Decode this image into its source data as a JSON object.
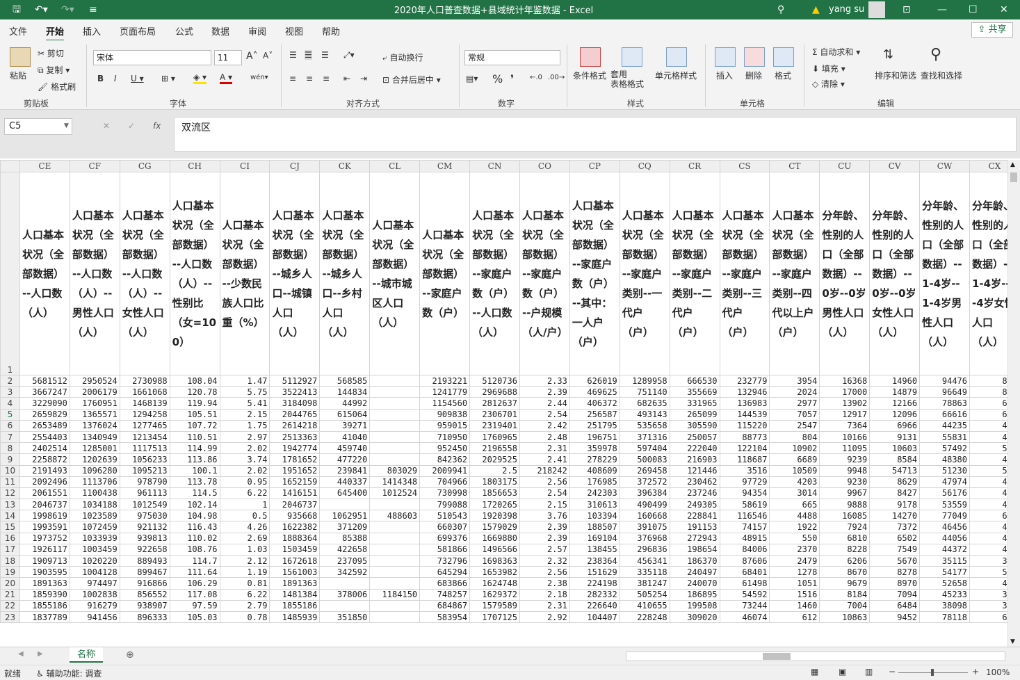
{
  "titlebar": {
    "title": "2020年人口普查数据+县域统计年鉴数据  -  Excel",
    "user": "yang su"
  },
  "menu": {
    "tabs": [
      "文件",
      "开始",
      "插入",
      "页面布局",
      "公式",
      "数据",
      "审阅",
      "视图",
      "帮助"
    ],
    "active": "开始",
    "share": "共享"
  },
  "ribbon": {
    "paste": "粘贴",
    "cut": "剪切",
    "copy": "复制",
    "format_painter": "格式刷",
    "clipboard": "剪贴板",
    "font_name": "宋体",
    "font_size": "11",
    "font_group": "字体",
    "wrap": "自动换行",
    "merge": "合并后居中",
    "align_group": "对齐方式",
    "num_format": "常规",
    "num_group": "数字",
    "cond_fmt": "条件格式",
    "table_fmt": "套用\n表格格式",
    "cell_style": "单元格样式",
    "style_group": "样式",
    "insert": "插入",
    "delete": "删除",
    "format": "格式",
    "cells_group": "单元格",
    "autosum": "自动求和",
    "fill": "填充",
    "clear": "清除",
    "sort": "排序和筛选",
    "find": "查找和选择",
    "edit_group": "编辑"
  },
  "formula_bar": {
    "name_box": "C5",
    "content": "双流区"
  },
  "columns": [
    "CE",
    "CF",
    "CG",
    "CH",
    "CI",
    "CJ",
    "CK",
    "CL",
    "CM",
    "CN",
    "CO",
    "CP",
    "CQ",
    "CR",
    "CS",
    "CT",
    "CU",
    "CV",
    "CW",
    "CX"
  ],
  "headers": [
    "人口基本状况（全部数据）--人口数（人）",
    "人口基本状况（全部数据）--人口数（人）--男性人口（人）",
    "人口基本状况（全部数据）--人口数（人）--女性人口（人）",
    "人口基本状况（全部数据）--人口数（人）--性别比（女=100）",
    "人口基本状况（全部数据）--少数民族人口比重（%）",
    "人口基本状况（全部数据）--城乡人口--城镇人口（人）",
    "人口基本状况（全部数据）--城乡人口--乡村人口（人）",
    "人口基本状况（全部数据）--城市城区人口（人）",
    "人口基本状况（全部数据）--家庭户数（户）",
    "人口基本状况（全部数据）--家庭户数（户）--人口数（人）",
    "人口基本状况（全部数据）--家庭户数（户）--户规模（人/户）",
    "人口基本状况（全部数据）--家庭户数（户）--其中：一人户（户）",
    "人口基本状况（全部数据）--家庭户类别--一代户（户）",
    "人口基本状况（全部数据）--家庭户类别--二代户（户）",
    "人口基本状况（全部数据）--家庭户类别--三代户（户）",
    "人口基本状况（全部数据）--家庭户类别--四代以上户（户）",
    "分年龄、性别的人口（全部数据）--0岁--0岁男性人口（人）",
    "分年龄、性别的人口（全部数据）--0岁--0岁女性人口（人）",
    "分年龄、性别的人口（全部数据）--1-4岁--1-4岁男性人口（人）",
    "分年龄、性别的人口（全部数据）--1-4岁--1-4岁女性人口（人）"
  ],
  "rows": [
    [
      "5681512",
      "2950524",
      "2730988",
      "108.04",
      "1.47",
      "5112927",
      "568585",
      "",
      "2193221",
      "5120736",
      "2.33",
      "626019",
      "1289958",
      "666530",
      "232779",
      "3954",
      "16368",
      "14960",
      "94476",
      "869"
    ],
    [
      "3667247",
      "2006179",
      "1661068",
      "120.78",
      "5.75",
      "3522413",
      "144834",
      "",
      "1241779",
      "2969688",
      "2.39",
      "469625",
      "751140",
      "355669",
      "132946",
      "2024",
      "17000",
      "14879",
      "96649",
      "837"
    ],
    [
      "3229090",
      "1760951",
      "1468139",
      "119.94",
      "5.41",
      "3184098",
      "44992",
      "",
      "1154560",
      "2812637",
      "2.44",
      "406372",
      "682635",
      "331965",
      "136983",
      "2977",
      "13902",
      "12166",
      "78863",
      "695"
    ],
    [
      "2659829",
      "1365571",
      "1294258",
      "105.51",
      "2.15",
      "2044765",
      "615064",
      "",
      "909838",
      "2306701",
      "2.54",
      "256587",
      "493143",
      "265099",
      "144539",
      "7057",
      "12917",
      "12096",
      "66616",
      "627"
    ],
    [
      "2653489",
      "1376024",
      "1277465",
      "107.72",
      "1.75",
      "2614218",
      "39271",
      "",
      "959015",
      "2319401",
      "2.42",
      "251795",
      "535658",
      "305590",
      "115220",
      "2547",
      "7364",
      "6966",
      "44235",
      "409"
    ],
    [
      "2554403",
      "1340949",
      "1213454",
      "110.51",
      "2.97",
      "2513363",
      "41040",
      "",
      "710950",
      "1760965",
      "2.48",
      "196751",
      "371316",
      "250057",
      "88773",
      "804",
      "10166",
      "9131",
      "55831",
      "496"
    ],
    [
      "2402514",
      "1285001",
      "1117513",
      "114.99",
      "2.02",
      "1942774",
      "459740",
      "",
      "952450",
      "2196558",
      "2.31",
      "359978",
      "597404",
      "222040",
      "122104",
      "10902",
      "11095",
      "10603",
      "57492",
      "529"
    ],
    [
      "2258872",
      "1202639",
      "1056233",
      "113.86",
      "3.74",
      "1781652",
      "477220",
      "",
      "842362",
      "2029525",
      "2.41",
      "278229",
      "500083",
      "216903",
      "118687",
      "6689",
      "9239",
      "8584",
      "48380",
      "446"
    ],
    [
      "2191493",
      "1096280",
      "1095213",
      "100.1",
      "2.02",
      "1951652",
      "239841",
      "803029",
      "2009941",
      "2.5",
      "218242",
      "408609",
      "269458",
      "121446",
      "3516",
      "10509",
      "9948",
      "54713",
      "51230",
      "589"
    ],
    [
      "2092496",
      "1113706",
      "978790",
      "113.78",
      "0.95",
      "1652159",
      "440337",
      "1414348",
      "704966",
      "1803175",
      "2.56",
      "176985",
      "372572",
      "230462",
      "97729",
      "4203",
      "9230",
      "8629",
      "47974",
      "443"
    ],
    [
      "2061551",
      "1100438",
      "961113",
      "114.5",
      "6.22",
      "1416151",
      "645400",
      "1012524",
      "730998",
      "1856653",
      "2.54",
      "242303",
      "396384",
      "237246",
      "94354",
      "3014",
      "9967",
      "8427",
      "56176",
      "455"
    ],
    [
      "2046737",
      "1034188",
      "1012549",
      "102.14",
      "1",
      "2046737",
      "",
      "",
      "799088",
      "1720265",
      "2.15",
      "310613",
      "490499",
      "249305",
      "58619",
      "665",
      "9888",
      "9178",
      "53559",
      "497"
    ],
    [
      "1998619",
      "1023589",
      "975030",
      "104.98",
      "0.5",
      "935668",
      "1062951",
      "488603",
      "510543",
      "1920398",
      "3.76",
      "103394",
      "160668",
      "228841",
      "116546",
      "4488",
      "16085",
      "14270",
      "77049",
      "692"
    ],
    [
      "1993591",
      "1072459",
      "921132",
      "116.43",
      "4.26",
      "1622382",
      "371209",
      "",
      "660307",
      "1579029",
      "2.39",
      "188507",
      "391075",
      "191153",
      "74157",
      "1922",
      "7924",
      "7372",
      "46456",
      "428"
    ],
    [
      "1973752",
      "1033939",
      "939813",
      "110.02",
      "2.69",
      "1888364",
      "85388",
      "",
      "699376",
      "1669880",
      "2.39",
      "169104",
      "376968",
      "272943",
      "48915",
      "550",
      "6810",
      "6502",
      "44056",
      "408"
    ],
    [
      "1926117",
      "1003459",
      "922658",
      "108.76",
      "1.03",
      "1503459",
      "422658",
      "",
      "581866",
      "1496566",
      "2.57",
      "138455",
      "296836",
      "198654",
      "84006",
      "2370",
      "8228",
      "7549",
      "44372",
      "400"
    ],
    [
      "1909713",
      "1020220",
      "889493",
      "114.7",
      "2.12",
      "1672618",
      "237095",
      "",
      "732796",
      "1698363",
      "2.32",
      "238364",
      "456341",
      "186370",
      "87606",
      "2479",
      "6206",
      "5670",
      "35115",
      "323"
    ],
    [
      "1903595",
      "1004128",
      "899467",
      "111.64",
      "1.19",
      "1561003",
      "342592",
      "",
      "645294",
      "1653982",
      "2.56",
      "151629",
      "335118",
      "240497",
      "68401",
      "1278",
      "8670",
      "8278",
      "54177",
      "507"
    ],
    [
      "1891363",
      "974497",
      "916866",
      "106.29",
      "0.81",
      "1891363",
      "",
      "",
      "683866",
      "1624748",
      "2.38",
      "224198",
      "381247",
      "240070",
      "61498",
      "1051",
      "9679",
      "8970",
      "52658",
      "497"
    ],
    [
      "1859390",
      "1002838",
      "856552",
      "117.08",
      "6.22",
      "1481384",
      "378006",
      "1184150",
      "748257",
      "1629372",
      "2.18",
      "282332",
      "505254",
      "186895",
      "54592",
      "1516",
      "8184",
      "7094",
      "45233",
      "389"
    ],
    [
      "1855186",
      "916279",
      "938907",
      "97.59",
      "2.79",
      "1855186",
      "",
      "",
      "684867",
      "1579589",
      "2.31",
      "226640",
      "410655",
      "199508",
      "73244",
      "1460",
      "7004",
      "6484",
      "38098",
      "357"
    ],
    [
      "1837789",
      "941456",
      "896333",
      "105.03",
      "0.78",
      "1485939",
      "351850",
      "",
      "583954",
      "1707125",
      "2.92",
      "104407",
      "228248",
      "309020",
      "46074",
      "612",
      "10863",
      "9452",
      "78118",
      "664"
    ]
  ],
  "sheet": {
    "tab": "名称"
  },
  "status": {
    "ready": "就绪",
    "accessibility": "辅助功能: 调查",
    "zoom": "100%"
  }
}
